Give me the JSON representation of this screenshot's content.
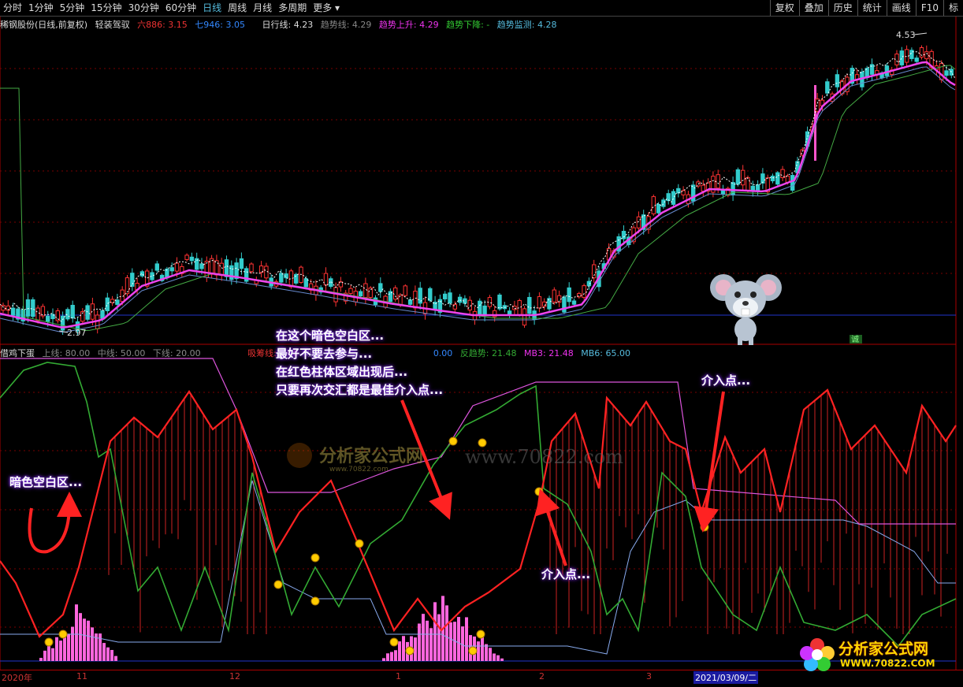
{
  "toolbar": {
    "tabs": [
      "分时",
      "1分钟",
      "5分钟",
      "15分钟",
      "30分钟",
      "60分钟",
      "日线",
      "周线",
      "月线",
      "多周期",
      "更多"
    ],
    "active": "日线",
    "right_buttons": [
      "复权",
      "叠加",
      "历史",
      "统计",
      "画线",
      "F10",
      "标"
    ]
  },
  "main_info": {
    "stock": "稀钢股份(日线,前复权)",
    "indicator": "轻装驾驭",
    "ma6": "六886: 3.15",
    "ma7": "七946: 3.05",
    "daily": "日行线: 4.23",
    "trend": "趋势线: 4.29",
    "trend_up": "趋势上升: 4.29",
    "trend_down": "趋势下降: -",
    "trend_mon": "趋势监测: 4.28"
  },
  "price_labels": {
    "high": "4.53",
    "low": "2.97"
  },
  "sub_info": {
    "name": "借鸡下蛋",
    "upper": "上线: 80.00",
    "middle": "中线: 50.00",
    "lower": "下线: 20.00",
    "chip": "吸筹线: 0.00",
    "chip2": "吸筹",
    "zero": "0.00",
    "reverse": "反趋势: 21.48",
    "mb3": "MB3: 21.48",
    "mb6": "MB6: 65.00"
  },
  "annotations": {
    "dark_zone": "暗色空白区...",
    "note1": "在这个暗色空白区...",
    "note2": "最好不要去参与...",
    "note3": "在红色柱体区域出现后...",
    "note4": "只要再次交汇都是最佳介入点...",
    "entry": "介入点...",
    "entry2": "介入点..."
  },
  "watermark": {
    "cn": "分析家公式网",
    "url": "www.70822.com",
    "url2": "www.70822.com"
  },
  "logo": {
    "title": "分析家公式网",
    "url": "WWW.70822.COM"
  },
  "axis_labels": [
    "2020年",
    "11",
    "12",
    "1",
    "2",
    "3",
    "2021/03/09/二"
  ],
  "mouse_tag": "诚"
}
